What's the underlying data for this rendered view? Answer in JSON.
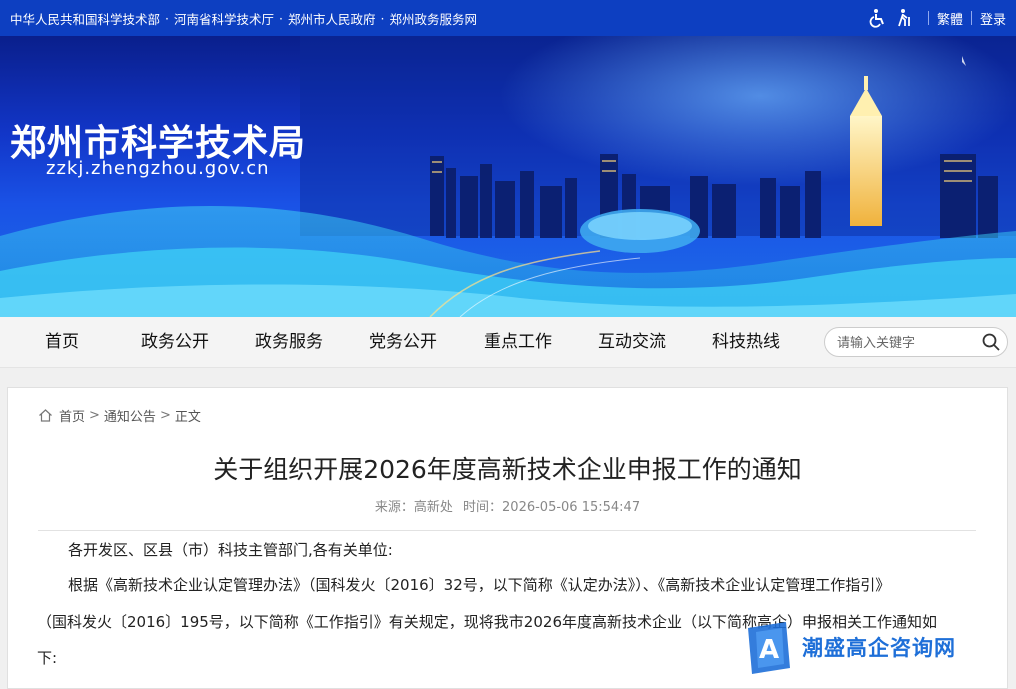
{
  "top_bar": {
    "links": [
      "中华人民共和国科学技术部",
      "河南省科学技术厅",
      "郑州市人民政府",
      "郑州政务服务网"
    ],
    "separator": "·",
    "traditional": "繁體",
    "login": "登录",
    "icons": [
      "accessibility-icon",
      "elder-mode-icon"
    ]
  },
  "banner": {
    "title": "郑州市科学技术局",
    "url": "zzkj.zhengzhou.gov.cn"
  },
  "nav": {
    "items": [
      "首页",
      "政务公开",
      "政务服务",
      "党务公开",
      "重点工作",
      "互动交流",
      "科技热线"
    ],
    "search_placeholder": "请输入关键字"
  },
  "breadcrumb": {
    "items": [
      "首页",
      "通知公告",
      "正文"
    ],
    "separator": ">"
  },
  "article": {
    "title": "关于组织开展2026年度高新技术企业申报工作的通知",
    "source": "来源：高新处",
    "time": "时间：2026-05-06 15:54:47",
    "paragraphs": [
      "各开发区、区县（市）科技主管部门,各有关单位:",
      "根据《高新技术企业认定管理办法》（国科发火〔2016〕32号，以下简称《认定办法》）、《高新技术企业认定管理工作指引》",
      "（国科发火〔2016〕195号，以下简称《工作指引》有关规定，现将我市2026年度高新技术企业（以下简称高企）申报相关工作通知如",
      "下:"
    ]
  },
  "watermark": {
    "text": "潮盛高企咨询网",
    "logo_letter": "A"
  },
  "colors": {
    "top_bar": "#0d3fc1",
    "banner_dark": "#0a1f8c",
    "banner_light": "#1d6fe8",
    "watermark": "#1e6fd8"
  }
}
